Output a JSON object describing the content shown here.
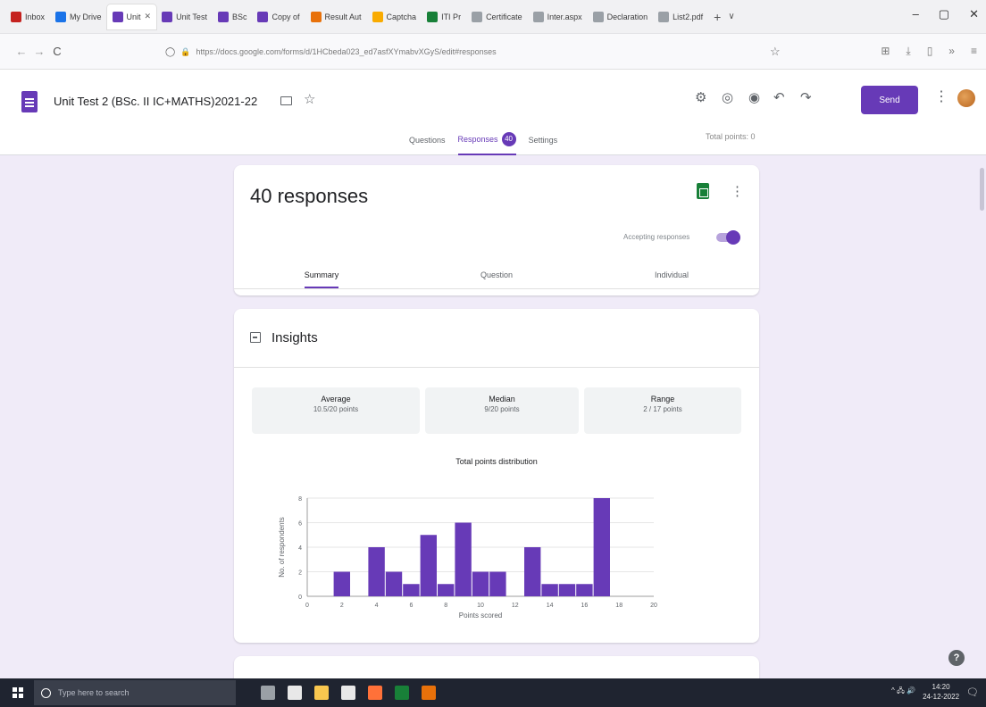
{
  "browser": {
    "tabs": [
      {
        "label": "Inbox",
        "color": "#c5221f",
        "active": false
      },
      {
        "label": "My Drive",
        "color": "#1a73e8",
        "active": false
      },
      {
        "label": "Unit",
        "color": "#673ab7",
        "active": true
      },
      {
        "label": "Unit Test",
        "color": "#673ab7",
        "active": false
      },
      {
        "label": "BSc",
        "color": "#673ab7",
        "active": false
      },
      {
        "label": "Copy of",
        "color": "#673ab7",
        "active": false
      },
      {
        "label": "Result Aut",
        "color": "#e8710a",
        "active": false
      },
      {
        "label": "Captcha",
        "color": "#f9ab00",
        "active": false
      },
      {
        "label": "ITI Pr",
        "color": "#188038",
        "active": false
      },
      {
        "label": "Certificate",
        "color": "#9aa0a6",
        "active": false
      },
      {
        "label": "Inter.aspx",
        "color": "#9aa0a6",
        "active": false
      },
      {
        "label": "Declaration",
        "color": "#9aa0a6",
        "active": false
      },
      {
        "label": "List2.pdf",
        "color": "#9aa0a6",
        "active": false
      }
    ],
    "new_tab": "+",
    "tab_list": "∨",
    "win_min": "–",
    "win_max": "▢",
    "win_close": "✕",
    "back": "←",
    "forward": "→",
    "reload": "C",
    "shield": "◯",
    "lock": "🔒",
    "url": "https://docs.google.com/forms/d/1HCbeda023_ed7asfXYmabvXGyS/edit#responses",
    "url_star": "☆",
    "nav_right": [
      "⊞",
      "⤓",
      "▯",
      "»",
      "≡"
    ]
  },
  "form": {
    "title": "Unit Test 2 (BSc. II IC+MATHS)2021-22",
    "star": "☆",
    "header_icons": [
      "⚙",
      "◎",
      "◉",
      "↶",
      "↷"
    ],
    "send_label": "Send",
    "more": "⋮",
    "tabs": {
      "questions": "Questions",
      "responses": "Responses",
      "responses_count": "40",
      "settings": "Settings"
    },
    "total_points": "Total points: 0"
  },
  "responses": {
    "title": "40 responses",
    "more": "⋮",
    "accepting_label": "Accepting responses",
    "accepting": true,
    "subtabs": {
      "summary": "Summary",
      "question": "Question",
      "individual": "Individual"
    }
  },
  "insights": {
    "title": "Insights",
    "stats": {
      "average": {
        "label": "Average",
        "value": "10.5/20 points"
      },
      "median": {
        "label": "Median",
        "value": "9/20 points"
      },
      "range": {
        "label": "Range",
        "value": "2 / 17 points"
      }
    }
  },
  "chart_data": {
    "type": "bar",
    "title": "Total points distribution",
    "xlabel": "Points scored",
    "ylabel": "No. of respondents",
    "x": [
      2,
      4,
      5,
      6,
      7,
      8,
      9,
      10,
      11,
      13,
      14,
      15,
      16,
      17
    ],
    "values": [
      2,
      4,
      2,
      1,
      5,
      1,
      6,
      2,
      2,
      4,
      1,
      1,
      1,
      8
    ],
    "xlim": [
      0,
      20
    ],
    "ylim": [
      0,
      8
    ],
    "xticks": [
      0,
      2,
      4,
      6,
      8,
      10,
      12,
      14,
      16,
      18,
      20
    ],
    "yticks": [
      0,
      2,
      4,
      6,
      8
    ],
    "bar_color": "#673ab7",
    "grid": true
  },
  "help": "?",
  "taskbar": {
    "search_placeholder": "Type here to search",
    "icons": [
      {
        "name": "task-view-icon",
        "color": "#9aa0a6"
      },
      {
        "name": "mail-icon",
        "color": "#e8e8e8"
      },
      {
        "name": "file-explorer-icon",
        "color": "#f9c74f"
      },
      {
        "name": "store-icon",
        "color": "#e8e8e8"
      },
      {
        "name": "firefox-icon",
        "color": "#ff7139"
      },
      {
        "name": "excel-icon",
        "color": "#188038"
      },
      {
        "name": "acrobat-icon",
        "color": "#e8710a"
      }
    ],
    "tray_icons": "^ 🖧 🔊",
    "time": "14:20",
    "date": "24-12-2022",
    "notifications": "🗨"
  }
}
